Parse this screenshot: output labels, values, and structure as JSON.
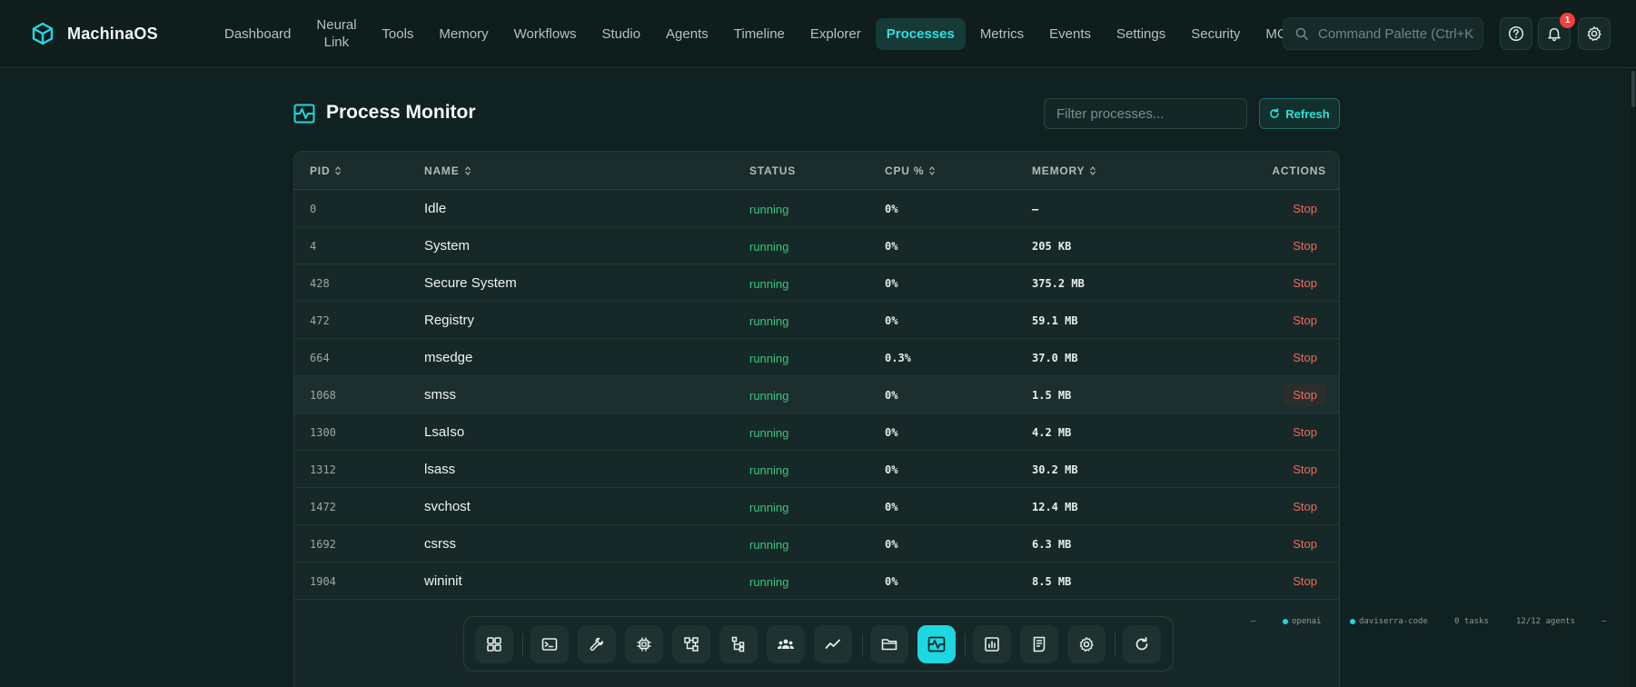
{
  "app": {
    "name": "MachinaOS"
  },
  "nav": {
    "items": [
      {
        "label": "Dashboard"
      },
      {
        "label": "Neural Link"
      },
      {
        "label": "Tools"
      },
      {
        "label": "Memory"
      },
      {
        "label": "Workflows"
      },
      {
        "label": "Studio"
      },
      {
        "label": "Agents"
      },
      {
        "label": "Timeline"
      },
      {
        "label": "Explorer"
      },
      {
        "label": "Processes",
        "active": true
      },
      {
        "label": "Metrics"
      },
      {
        "label": "Events"
      },
      {
        "label": "Settings"
      },
      {
        "label": "Security"
      },
      {
        "label": "MCP"
      }
    ],
    "command_palette_placeholder": "Command Palette (Ctrl+K",
    "notification_count": "1"
  },
  "page": {
    "title": "Process Monitor",
    "filter_placeholder": "Filter processes...",
    "refresh_label": "Refresh"
  },
  "table": {
    "headers": {
      "pid": "PID",
      "name": "NAME",
      "status": "STATUS",
      "cpu": "CPU %",
      "memory": "MEMORY",
      "actions": "ACTIONS"
    },
    "rows": [
      {
        "pid": "0",
        "name": "Idle",
        "status": "running",
        "cpu": "0%",
        "memory": "—",
        "action": "Stop"
      },
      {
        "pid": "4",
        "name": "System",
        "status": "running",
        "cpu": "0%",
        "memory": "205 KB",
        "action": "Stop"
      },
      {
        "pid": "428",
        "name": "Secure System",
        "status": "running",
        "cpu": "0%",
        "memory": "375.2 MB",
        "action": "Stop"
      },
      {
        "pid": "472",
        "name": "Registry",
        "status": "running",
        "cpu": "0%",
        "memory": "59.1 MB",
        "action": "Stop"
      },
      {
        "pid": "664",
        "name": "msedge",
        "status": "running",
        "cpu": "0.3%",
        "memory": "37.0 MB",
        "action": "Stop"
      },
      {
        "pid": "1068",
        "name": "smss",
        "status": "running",
        "cpu": "0%",
        "memory": "1.5 MB",
        "action": "Stop"
      },
      {
        "pid": "1300",
        "name": "LsaIso",
        "status": "running",
        "cpu": "0%",
        "memory": "4.2 MB",
        "action": "Stop"
      },
      {
        "pid": "1312",
        "name": "lsass",
        "status": "running",
        "cpu": "0%",
        "memory": "30.2 MB",
        "action": "Stop"
      },
      {
        "pid": "1472",
        "name": "svchost",
        "status": "running",
        "cpu": "0%",
        "memory": "12.4 MB",
        "action": "Stop"
      },
      {
        "pid": "1692",
        "name": "csrss",
        "status": "running",
        "cpu": "0%",
        "memory": "6.3 MB",
        "action": "Stop"
      },
      {
        "pid": "1904",
        "name": "wininit",
        "status": "running",
        "cpu": "0%",
        "memory": "8.5 MB",
        "action": "Stop"
      }
    ]
  },
  "status_bar": {
    "left_dash": "—",
    "provider": "openai",
    "user": "daviserra-code",
    "tasks": "0 tasks",
    "agents": "12/12 agents",
    "right_dash": "—"
  },
  "colors": {
    "accent": "#1fd7e0",
    "running": "#34c77b",
    "stop": "#f06b5a",
    "badge": "#f04141"
  },
  "dock": {
    "icons": [
      "dashboard-icon",
      "terminal-icon",
      "tools-icon",
      "chip-icon",
      "workflow-icon",
      "tree-icon",
      "agents-icon",
      "metrics-line-icon",
      "folder-icon",
      "process-monitor-icon",
      "report-icon",
      "document-icon",
      "settings-icon",
      "refresh-icon"
    ]
  }
}
